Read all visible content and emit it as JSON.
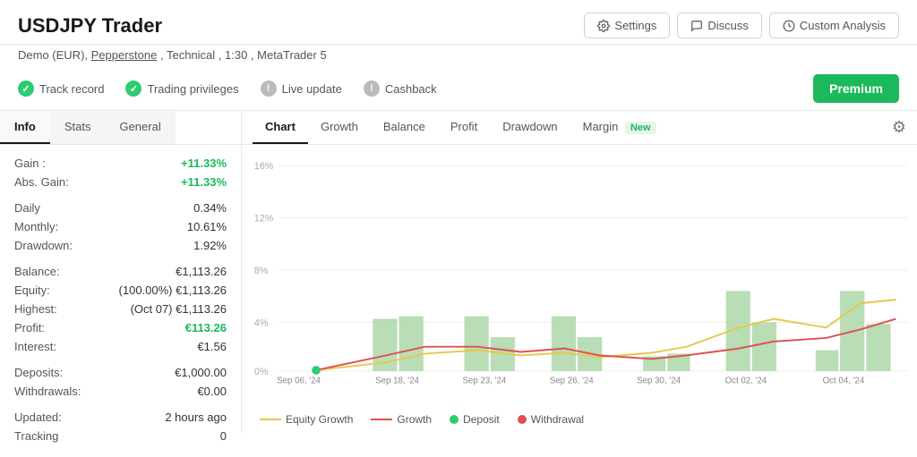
{
  "header": {
    "title": "USDJPY Trader",
    "settings_label": "Settings",
    "discuss_label": "Discuss",
    "custom_analysis_label": "Custom Analysis"
  },
  "subtitle": {
    "text": "Demo (EUR), Pepperstone , Technical , 1:30 , MetaTrader 5",
    "broker_link": "Pepperstone"
  },
  "status_bar": {
    "items": [
      {
        "id": "track-record",
        "icon": "check",
        "label": "Track record"
      },
      {
        "id": "trading-privileges",
        "icon": "check",
        "label": "Trading privileges"
      },
      {
        "id": "live-update",
        "icon": "info",
        "label": "Live update"
      },
      {
        "id": "cashback",
        "icon": "info",
        "label": "Cashback"
      }
    ],
    "premium_label": "Premium"
  },
  "left_panel": {
    "tabs": [
      {
        "id": "info",
        "label": "Info",
        "active": true
      },
      {
        "id": "stats",
        "label": "Stats",
        "active": false
      },
      {
        "id": "general",
        "label": "General",
        "active": false
      }
    ],
    "info": {
      "rows": [
        {
          "label": "Gain :",
          "value": "+11.33%",
          "green": true
        },
        {
          "label": "Abs. Gain:",
          "value": "+11.33%",
          "green": true
        },
        {
          "spacer": true
        },
        {
          "label": "Daily",
          "value": "0.34%"
        },
        {
          "label": "Monthly:",
          "value": "10.61%"
        },
        {
          "label": "Drawdown:",
          "value": "1.92%"
        },
        {
          "spacer": true
        },
        {
          "label": "Balance:",
          "value": "€1,113.26"
        },
        {
          "label": "Equity:",
          "value": "(100.00%) €1,113.26"
        },
        {
          "label": "Highest:",
          "value": "(Oct 07) €1,113.26"
        },
        {
          "label": "Profit:",
          "value": "€113.26",
          "green": true
        },
        {
          "label": "Interest:",
          "value": "€1.56"
        },
        {
          "spacer": true
        },
        {
          "label": "Deposits:",
          "value": "€1,000.00"
        },
        {
          "label": "Withdrawals:",
          "value": "€0.00"
        },
        {
          "spacer": true
        },
        {
          "label": "Updated:",
          "value": "2 hours ago"
        },
        {
          "label": "Tracking",
          "value": "0"
        }
      ]
    }
  },
  "chart_panel": {
    "tabs": [
      {
        "id": "chart",
        "label": "Chart",
        "active": true
      },
      {
        "id": "growth",
        "label": "Growth",
        "active": false
      },
      {
        "id": "balance",
        "label": "Balance",
        "active": false
      },
      {
        "id": "profit",
        "label": "Profit",
        "active": false
      },
      {
        "id": "drawdown",
        "label": "Drawdown",
        "active": false
      },
      {
        "id": "margin",
        "label": "Margin",
        "active": false,
        "badge": "New"
      }
    ],
    "y_labels": [
      "16%",
      "12%",
      "8%",
      "4%",
      "0%"
    ],
    "x_labels": [
      "Sep 06, '24",
      "Sep 18, '24",
      "Sep 23, '24",
      "Sep 26, '24",
      "Sep 30, '24",
      "Oct 02, '24",
      "Oct 04, '24"
    ],
    "legend": [
      {
        "type": "line",
        "color": "#e6c84a",
        "label": "Equity Growth"
      },
      {
        "type": "line",
        "color": "#e05050",
        "label": "Growth"
      },
      {
        "type": "dot",
        "color": "#2ecc71",
        "label": "Deposit"
      },
      {
        "type": "dot",
        "color": "#e05050",
        "label": "Withdrawal"
      }
    ]
  }
}
